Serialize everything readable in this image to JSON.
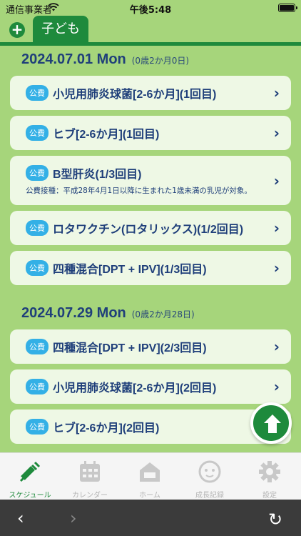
{
  "status_bar": {
    "carrier": "通信事業者",
    "time": "午後5:48"
  },
  "top": {
    "add_icon": "plus-circle-icon",
    "tab_label": "子ども"
  },
  "sections": [
    {
      "date": "2024.07.01 Mon",
      "age": "(0歳2か月0日)",
      "items": [
        {
          "badge": "公費",
          "name": "小児用肺炎球菌[2-6か月](1回目)"
        },
        {
          "badge": "公費",
          "name": "ヒブ[2-6か月](1回目)"
        },
        {
          "badge": "公費",
          "name": "B型肝炎(1/3回目)",
          "note": "公費接種：平成28年4月1日以降に生まれた1歳未満の乳児が対象。"
        },
        {
          "badge": "公費",
          "name": "ロタワクチン(ロタリックス)(1/2回目)"
        },
        {
          "badge": "公費",
          "name": "四種混合[DPT + IPV](1/3回目)"
        }
      ]
    },
    {
      "date": "2024.07.29 Mon",
      "age": "(0歳2か月28日)",
      "items": [
        {
          "badge": "公費",
          "name": "四種混合[DPT + IPV](2/3回目)"
        },
        {
          "badge": "公費",
          "name": "小児用肺炎球菌[2-6か月](2回目)"
        },
        {
          "badge": "公費",
          "name": "ヒブ[2-6か月](2回目)"
        }
      ]
    }
  ],
  "fab": {
    "icon": "arrow-up-icon"
  },
  "bottom_tabs": [
    {
      "label": "スケジュール",
      "icon": "syringe-icon",
      "active": true
    },
    {
      "label": "カレンダー",
      "icon": "calendar-icon",
      "active": false
    },
    {
      "label": "ホーム",
      "icon": "home-icon",
      "active": false
    },
    {
      "label": "成長記録",
      "icon": "baby-face-icon",
      "active": false
    },
    {
      "label": "設定",
      "icon": "gear-icon",
      "active": false
    }
  ],
  "browser_bar": {
    "back": "‹",
    "forward": "›",
    "reload": "↻"
  },
  "colors": {
    "background": "#a6d57b",
    "primary": "#1e8a3c",
    "card": "#eef8e5",
    "text": "#1f3f7a",
    "badge": "#33b0e6"
  }
}
